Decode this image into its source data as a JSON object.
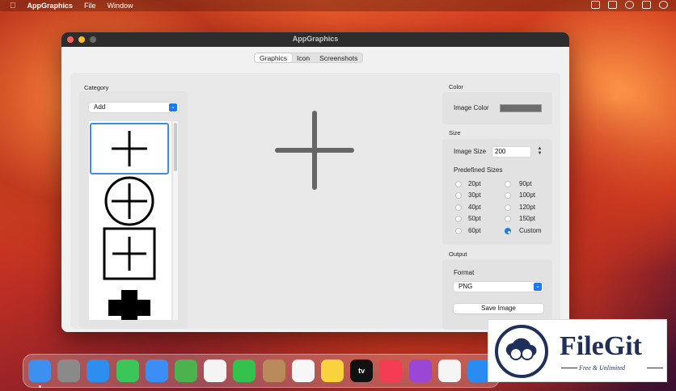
{
  "menubar": {
    "app_name": "AppGraphics",
    "items": [
      "File",
      "Window"
    ]
  },
  "window": {
    "title": "AppGraphics",
    "tabs": [
      {
        "label": "Graphics",
        "active": true
      },
      {
        "label": "Icon",
        "active": false
      },
      {
        "label": "Screenshots",
        "active": false
      }
    ]
  },
  "category": {
    "label": "Category",
    "selected": "Add",
    "items": [
      "plus",
      "plus-circle",
      "plus-square",
      "plus-filled"
    ],
    "selected_index": 0
  },
  "color": {
    "label": "Color",
    "image_color_label": "Image Color",
    "image_color": "#6c6c6c"
  },
  "size": {
    "label": "Size",
    "image_size_label": "Image Size",
    "image_size_value": "200",
    "predefined_label": "Predefined Sizes",
    "options": [
      {
        "label": "20pt",
        "checked": false
      },
      {
        "label": "30pt",
        "checked": false
      },
      {
        "label": "40pt",
        "checked": false
      },
      {
        "label": "50pt",
        "checked": false
      },
      {
        "label": "60pt",
        "checked": false
      },
      {
        "label": "90pt",
        "checked": false
      },
      {
        "label": "100pt",
        "checked": false
      },
      {
        "label": "120pt",
        "checked": false
      },
      {
        "label": "150pt",
        "checked": false
      },
      {
        "label": "Custom",
        "checked": true
      }
    ]
  },
  "output": {
    "label": "Output",
    "format_label": "Format",
    "format_value": "PNG",
    "save_label": "Save Image"
  },
  "dock": {
    "apps": [
      {
        "icon": "finder-icon",
        "color": "#3d8ff0"
      },
      {
        "icon": "launchpad-icon",
        "color": "#8a8a8a"
      },
      {
        "icon": "safari-icon",
        "color": "#2d8ef0"
      },
      {
        "icon": "messages-icon",
        "color": "#3cc65a"
      },
      {
        "icon": "mail-icon",
        "color": "#3a8ef5"
      },
      {
        "icon": "maps-icon",
        "color": "#4cb24e"
      },
      {
        "icon": "photos-icon",
        "color": "#f4f4f4"
      },
      {
        "icon": "facetime-icon",
        "color": "#33c24e"
      },
      {
        "icon": "contacts-icon",
        "color": "#b98a5a"
      },
      {
        "icon": "reminders-icon",
        "color": "#f7f7f7"
      },
      {
        "icon": "notes-icon",
        "color": "#f9d33d"
      },
      {
        "icon": "tv-icon",
        "color": "#111111"
      },
      {
        "icon": "music-icon",
        "color": "#f43c55"
      },
      {
        "icon": "podcasts-icon",
        "color": "#9b47d6"
      },
      {
        "icon": "news-icon",
        "color": "#f5f5f5"
      },
      {
        "icon": "app-store-icon",
        "color": "#2a8cf2"
      }
    ],
    "tv_label": "tv"
  },
  "watermark": {
    "brand": "FileGit",
    "tagline": "Free & Unlimited"
  }
}
